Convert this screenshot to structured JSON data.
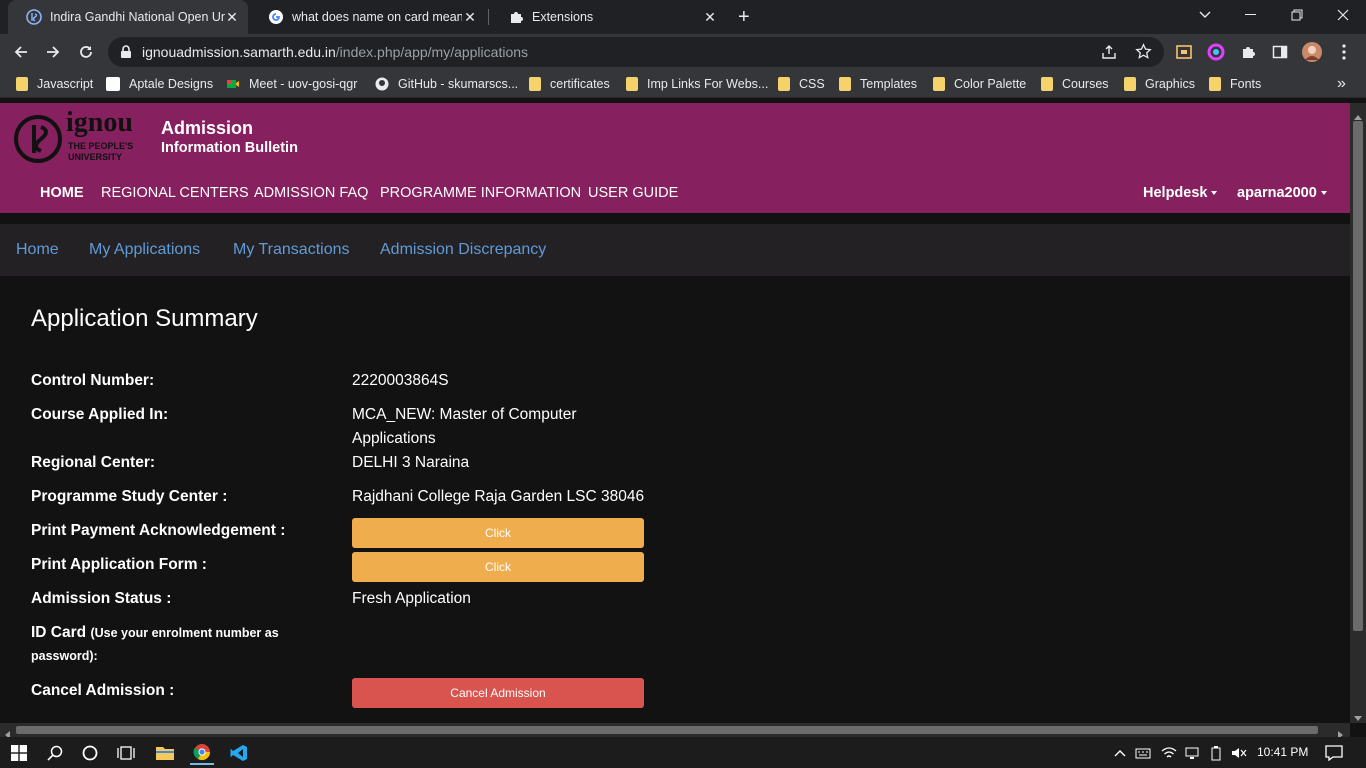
{
  "browser": {
    "tabs": [
      {
        "title": "Indira Gandhi National Open Uni",
        "icon": "ignou-favicon",
        "active": true
      },
      {
        "title": "what does name on card mean -",
        "icon": "google-icon",
        "active": false
      },
      {
        "title": "Extensions",
        "icon": "puzzle-icon",
        "active": false
      }
    ],
    "new_tab": "+",
    "url_host": "ignouadmission.samarth.edu.in",
    "url_path": "/index.php/app/my/applications",
    "bookmarks": [
      {
        "label": "Javascript",
        "icon": "folder-icon"
      },
      {
        "label": "Aptale Designs",
        "icon": "aptale-icon"
      },
      {
        "label": "Meet - uov-gosi-qgr",
        "icon": "meet-icon"
      },
      {
        "label": "GitHub - skumarscs...",
        "icon": "github-icon"
      },
      {
        "label": "certificates",
        "icon": "folder-icon"
      },
      {
        "label": "Imp Links For Webs...",
        "icon": "folder-icon"
      },
      {
        "label": "CSS",
        "icon": "folder-icon"
      },
      {
        "label": "Templates",
        "icon": "folder-icon"
      },
      {
        "label": "Color Palette",
        "icon": "folder-icon"
      },
      {
        "label": "Courses",
        "icon": "folder-icon"
      },
      {
        "label": "Graphics",
        "icon": "folder-icon"
      },
      {
        "label": "Fonts",
        "icon": "folder-icon"
      }
    ],
    "more_bookmarks": "»"
  },
  "site": {
    "logo_text": "ignou",
    "logo_tagline_1": "THE PEOPLE'S",
    "logo_tagline_2": "UNIVERSITY",
    "title": "Admission",
    "subtitle": "Information Bulletin",
    "nav": [
      "HOME",
      "REGIONAL CENTERS",
      "ADMISSION FAQ",
      "PROGRAMME INFORMATION",
      "USER GUIDE"
    ],
    "helpdesk": "Helpdesk",
    "user": "aparna2000",
    "subnav": [
      "Home",
      "My Applications",
      "My Transactions",
      "Admission Discrepancy"
    ],
    "brand_color": "#86205f"
  },
  "summary": {
    "title": "Application Summary",
    "control_label": "Control Number:",
    "control_value": "2220003864S",
    "course_label": "Course Applied In:",
    "course_value_1": "MCA_NEW: Master of Computer",
    "course_value_2": "Applications",
    "region_label": "Regional Center:",
    "region_value": "DELHI 3 Naraina",
    "study_label": "Programme Study Center :",
    "study_value": "Rajdhani College Raja Garden LSC 38046",
    "payment_label": "Print Payment Acknowledgement :",
    "payment_button": "Click",
    "form_label": "Print Application Form :",
    "form_button": "Click",
    "status_label": "Admission Status :",
    "status_value": "Fresh Application",
    "idcard_label": "ID Card",
    "idcard_note_1": "(Use your enrolment number as",
    "idcard_note_2": "password):",
    "cancel_label": "Cancel Admission :",
    "cancel_button": "Cancel Admission"
  },
  "taskbar": {
    "time": "10:41 PM"
  }
}
